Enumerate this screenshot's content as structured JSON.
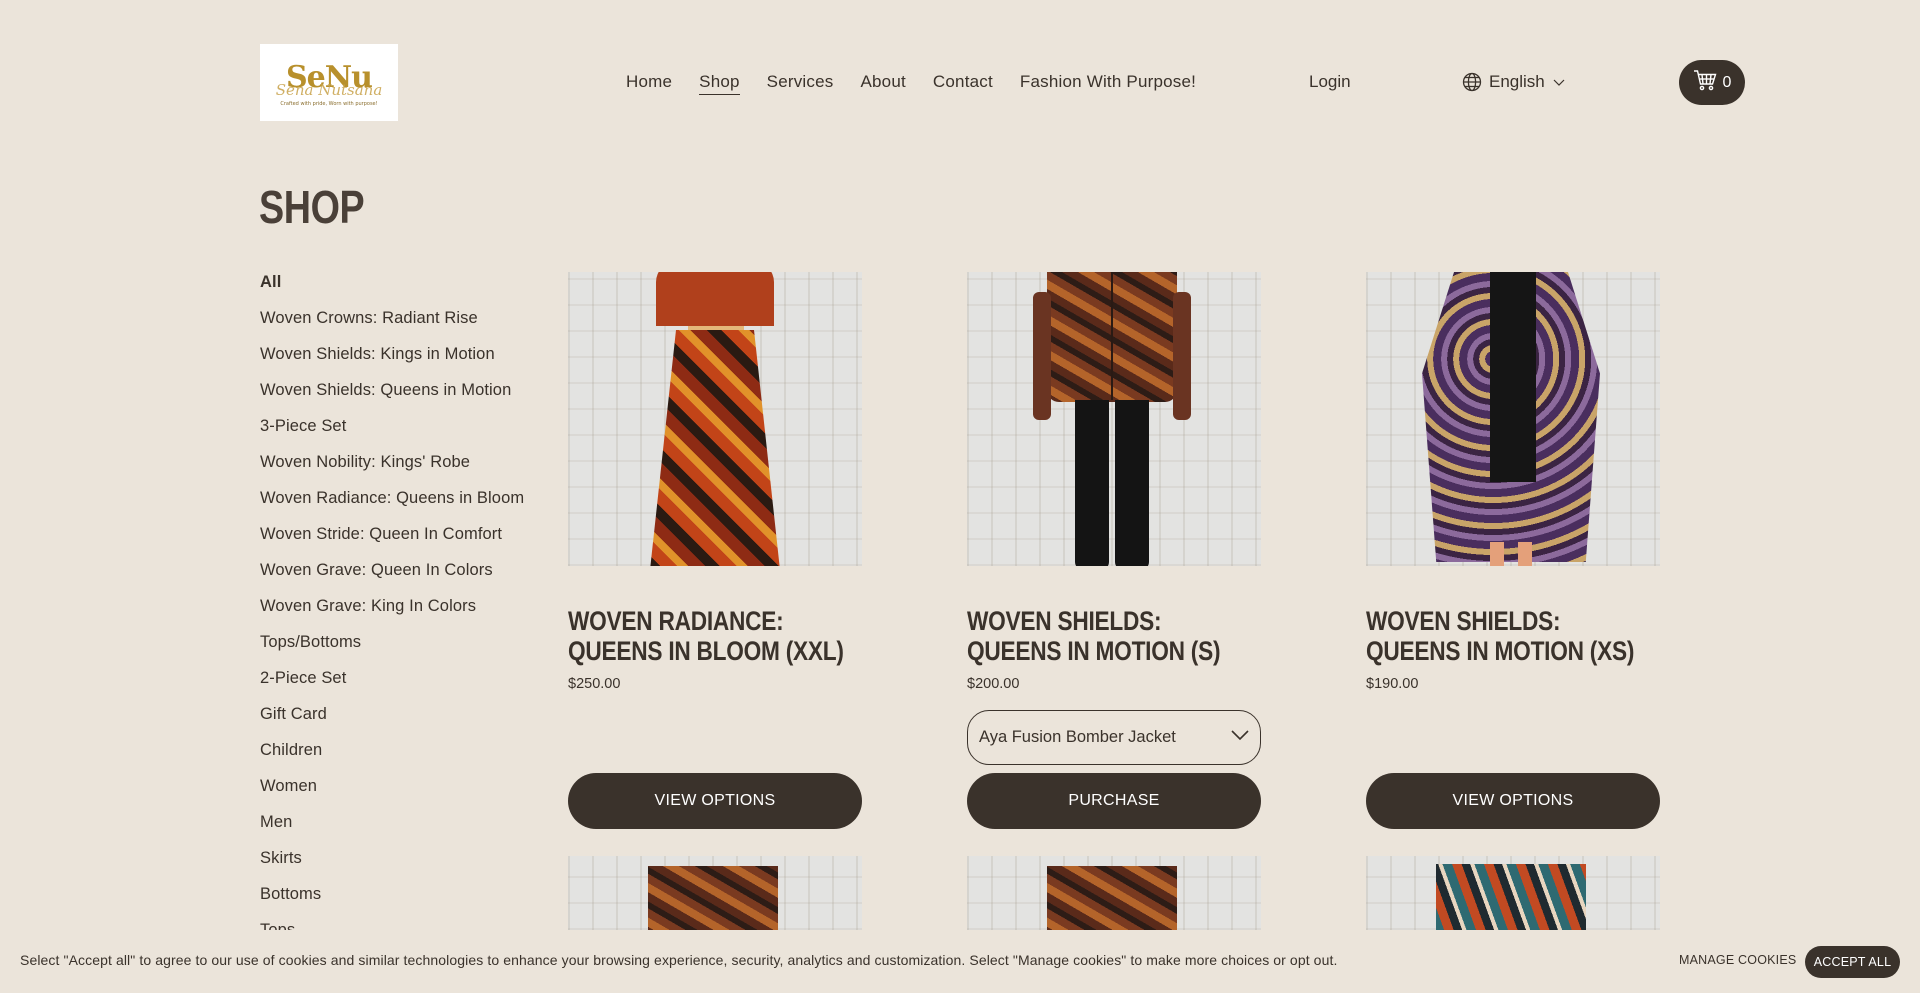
{
  "brand": {
    "logo_mark": "SeNu",
    "logo_script": "Sena Nutsana",
    "logo_tagline": "Crafted with pride, Worn with purpose!"
  },
  "nav": {
    "items": [
      "Home",
      "Shop",
      "Services",
      "About",
      "Contact",
      "Fashion With Purpose!"
    ],
    "active": "Shop",
    "login": "Login",
    "language": "English",
    "cart_count": "0"
  },
  "page": {
    "title": "SHOP"
  },
  "categories": [
    "All",
    "Woven Crowns: Radiant Rise",
    "Woven Shields: Kings in Motion",
    "Woven Shields: Queens in Motion",
    "3-Piece Set",
    "Woven Nobility: Kings' Robe",
    "Woven Radiance: Queens in Bloom",
    "Woven Stride: Queen In Comfort",
    "Woven Grave: Queen In Colors",
    "Woven Grave: King In Colors",
    "Tops/Bottoms",
    "2-Piece Set",
    "Gift Card",
    "Children",
    "Women",
    "Men",
    "Skirts",
    "Bottoms",
    "Tops"
  ],
  "products": [
    {
      "title": "Woven Radiance: Queens in Bloom (XXL)",
      "price": "$250.00",
      "button": "VIEW OPTIONS"
    },
    {
      "title": "Woven Shields: Queens in Motion (S)",
      "price": "$200.00",
      "select_value": "Aya Fusion Bomber Jacket",
      "button": "PURCHASE"
    },
    {
      "title": "Woven Shields: Queens in Motion (XS)",
      "price": "$190.00",
      "button": "VIEW OPTIONS"
    }
  ],
  "cookie": {
    "text": "Select \"Accept all\" to agree to our use of cookies and similar technologies to enhance your browsing experience, security, analytics and customization. Select \"Manage cookies\" to make more choices or opt out.",
    "manage": "MANAGE COOKIES",
    "accept": "ACCEPT ALL"
  },
  "colors": {
    "background": "#ebe4da",
    "primary": "#3a322b",
    "logo_gold": "#b8902c"
  },
  "icons": [
    "globe-icon",
    "chevron-down-icon",
    "cart-icon"
  ]
}
